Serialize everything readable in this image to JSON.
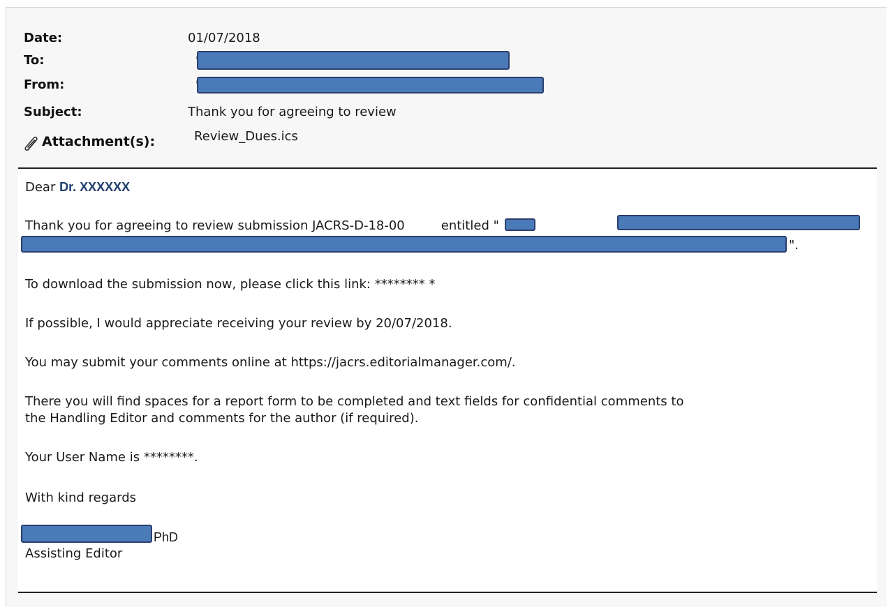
{
  "header": {
    "date_label": "Date:",
    "date_value": "01/07/2018",
    "to_label": "To:",
    "from_label": "From:",
    "subject_label": "Subject:",
    "subject_value": "Thank you for agreeing to review",
    "attachments_label": "Attachment(s):",
    "attachment_file": "Review_Dues.ics",
    "attachment_icon": "paperclip-icon",
    "quote_mark": "\""
  },
  "body": {
    "greeting_prefix": "Dear",
    "greeting_name": "Dr. XXXXXX",
    "para1_start": "Thank you for agreeing to review submission JACRS-D-18-00",
    "para1_mid": "entitled \"",
    "para1_end": "\".",
    "download_text": "To download the submission now, please click this link: ******** *",
    "due_text": "If possible, I would appreciate receiving your review by 20/07/2018.",
    "submit_text": "You may submit your comments online at https://jacrs.editorialmanager.com/.",
    "spaces_line1": "There you will find spaces for a report form to be completed and text fields for confidential comments to",
    "spaces_line2": "the Handling Editor and comments for the author (if required).",
    "username_text": "Your User Name is ********.",
    "closing": "With kind regards",
    "signature_suffix": "PhD",
    "signature_title": "Assisting Editor"
  },
  "colors": {
    "redaction_fill": "#4a7ab8",
    "redaction_border": "#2c3e6d",
    "name_highlight": "#1f3f6e"
  }
}
